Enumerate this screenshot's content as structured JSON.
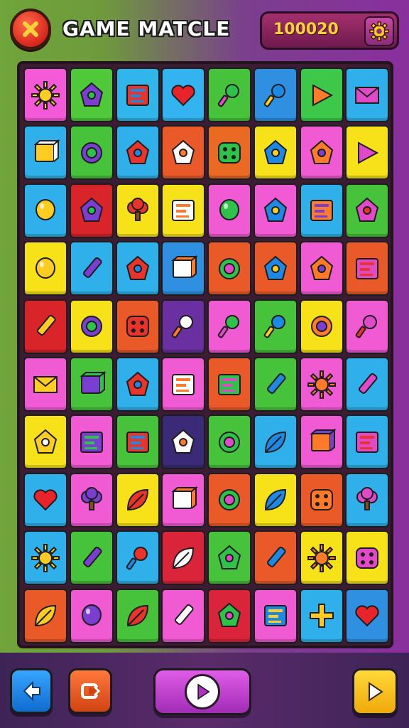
{
  "header": {
    "title": "GAME MATCLE",
    "score": "100020",
    "close_icon": "close-icon",
    "settings_icon": "gear-icon"
  },
  "board": {
    "rows": 10,
    "cols": 8,
    "tiles": [
      [
        {
          "icon": "sun-icon",
          "bg": "#f45ad8"
        },
        {
          "icon": "hand-icon",
          "bg": "#4fc93a"
        },
        {
          "icon": "barcode-icon",
          "bg": "#31b6ec"
        },
        {
          "icon": "heart-icon",
          "bg": "#33b3ef"
        },
        {
          "icon": "pin-icon",
          "bg": "#47c23b"
        },
        {
          "icon": "rocket-icon",
          "bg": "#2f8fe0"
        },
        {
          "icon": "play-triangle-icon",
          "bg": "#3ec84a"
        },
        {
          "icon": "envelope-icon",
          "bg": "#2fb0ea"
        }
      ],
      [
        {
          "icon": "gift-icon",
          "bg": "#2fb0ea"
        },
        {
          "icon": "ring-icon",
          "bg": "#47c23b"
        },
        {
          "icon": "planet-icon",
          "bg": "#2fb0ea"
        },
        {
          "icon": "monster-icon",
          "bg": "#ea5a28"
        },
        {
          "icon": "speech-bubble-icon",
          "bg": "#ea6a24"
        },
        {
          "icon": "eraser-icon",
          "bg": "#f7e21a"
        },
        {
          "icon": "camera-icon",
          "bg": "#f05ad2"
        },
        {
          "icon": "arrow-icon",
          "bg": "#f7e21a"
        }
      ],
      [
        {
          "icon": "ball-icon",
          "bg": "#2fb0ea"
        },
        {
          "icon": "cog-badge-icon",
          "bg": "#d9242a"
        },
        {
          "icon": "tree-icon",
          "bg": "#f7e21a"
        },
        {
          "icon": "card-icon",
          "bg": "#f7e21a"
        },
        {
          "icon": "bomb-icon",
          "bg": "#f05ad2"
        },
        {
          "icon": "lantern-icon",
          "bg": "#f05ad2"
        },
        {
          "icon": "frame-icon",
          "bg": "#2fb0ea"
        },
        {
          "icon": "bucket-icon",
          "bg": "#47c23b"
        }
      ],
      [
        {
          "icon": "balloon-icon",
          "bg": "#f7e21a"
        },
        {
          "icon": "battery-icon",
          "bg": "#2fb0ea"
        },
        {
          "icon": "gear-small-icon",
          "bg": "#2fb0ea"
        },
        {
          "icon": "box-icon",
          "bg": "#2f8fe0"
        },
        {
          "icon": "target-icon",
          "bg": "#ea5a28"
        },
        {
          "icon": "eye-icon",
          "bg": "#ea5a28"
        },
        {
          "icon": "splat-icon",
          "bg": "#f05ad2"
        },
        {
          "icon": "radio-icon",
          "bg": "#ea5a28"
        }
      ],
      [
        {
          "icon": "pencil-icon",
          "bg": "#d9242a"
        },
        {
          "icon": "lens-icon",
          "bg": "#f7e21a"
        },
        {
          "icon": "dice-icon",
          "bg": "#ea5a28"
        },
        {
          "icon": "key-icon",
          "bg": "#6a2fa0"
        },
        {
          "icon": "lollipop-icon",
          "bg": "#f05ad2"
        },
        {
          "icon": "pushpin-icon",
          "bg": "#47c23b"
        },
        {
          "icon": "donut-icon",
          "bg": "#f7e21a"
        },
        {
          "icon": "magnet-icon",
          "bg": "#f05ad2"
        }
      ],
      [
        {
          "icon": "envelope-open-icon",
          "bg": "#f05ad2"
        },
        {
          "icon": "cube-icon",
          "bg": "#47c23b"
        },
        {
          "icon": "blob-icon",
          "bg": "#2fb0ea"
        },
        {
          "icon": "document-icon",
          "bg": "#f05ad2"
        },
        {
          "icon": "books-icon",
          "bg": "#ea5a28"
        },
        {
          "icon": "marker-icon",
          "bg": "#47c23b"
        },
        {
          "icon": "star-burst-icon",
          "bg": "#f05ad2"
        },
        {
          "icon": "crayon-icon",
          "bg": "#2fb0ea"
        }
      ],
      [
        {
          "icon": "can-icon",
          "bg": "#f7e21a"
        },
        {
          "icon": "projector-icon",
          "bg": "#f05ad2"
        },
        {
          "icon": "window-icon",
          "bg": "#47c23b"
        },
        {
          "icon": "star-fold-icon",
          "bg": "#3a2a78"
        },
        {
          "icon": "ring-face-icon",
          "bg": "#47c23b"
        },
        {
          "icon": "leaf-pair-icon",
          "bg": "#2fb0ea"
        },
        {
          "icon": "safe-icon",
          "bg": "#f05ad2"
        },
        {
          "icon": "app-icon",
          "bg": "#2fb0ea"
        }
      ],
      [
        {
          "icon": "heart-arrow-icon",
          "bg": "#2fb0ea"
        },
        {
          "icon": "cloud-icon",
          "bg": "#f05ad2"
        },
        {
          "icon": "leaf-icon",
          "bg": "#f7e21a"
        },
        {
          "icon": "green-cube-icon",
          "bg": "#f05ad2"
        },
        {
          "icon": "disc-icon",
          "bg": "#ea5a28"
        },
        {
          "icon": "feather-icon",
          "bg": "#f7e21a"
        },
        {
          "icon": "cheese-icon",
          "bg": "#ea5a28"
        },
        {
          "icon": "mushroom-icon",
          "bg": "#2fb0ea"
        }
      ],
      [
        {
          "icon": "sunflower-icon",
          "bg": "#2fb0ea"
        },
        {
          "icon": "pen-icon",
          "bg": "#47c23b"
        },
        {
          "icon": "dart-icon",
          "bg": "#2fb0ea"
        },
        {
          "icon": "palm-icon",
          "bg": "#d9243a"
        },
        {
          "icon": "face-icon",
          "bg": "#47c23b"
        },
        {
          "icon": "tube-icon",
          "bg": "#ea5a28"
        },
        {
          "icon": "virus-icon",
          "bg": "#f7e21a"
        },
        {
          "icon": "puzzle-icon",
          "bg": "#f7e21a"
        }
      ],
      [
        {
          "icon": "leaf-oval-icon",
          "bg": "#ea5a28"
        },
        {
          "icon": "egg-icon",
          "bg": "#f05ad2"
        },
        {
          "icon": "feather-circle-icon",
          "bg": "#47c23b"
        },
        {
          "icon": "capsule-icon",
          "bg": "#f05ad2"
        },
        {
          "icon": "piece-icon",
          "bg": "#d9243a"
        },
        {
          "icon": "calculator-icon",
          "bg": "#f05ad2"
        },
        {
          "icon": "plus-icon",
          "bg": "#2fb0ea"
        },
        {
          "icon": "heart-red-icon",
          "bg": "#2f8fe0"
        }
      ]
    ]
  },
  "footer": {
    "back_icon": "arrow-left-icon",
    "restart_icon": "restart-icon",
    "play_icon": "play-icon",
    "next_icon": "next-icon"
  }
}
